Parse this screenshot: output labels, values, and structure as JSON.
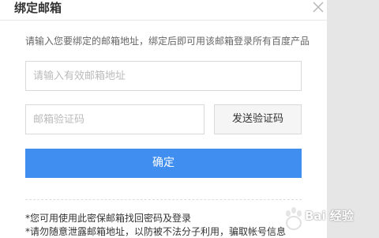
{
  "dialog": {
    "title": "绑定邮箱",
    "intro": "请输入您要绑定的邮箱地址，绑定后即可用该邮箱登录所有百度产品",
    "email_input": {
      "value": "",
      "placeholder": "请输入有效邮箱地址"
    },
    "code_input": {
      "value": "",
      "placeholder": "邮箱验证码"
    },
    "send_code_label": "发送验证码",
    "confirm_label": "确定",
    "notes": [
      "*您可用使用此密保邮箱找回密码及登录",
      "*请勿随意泄露邮箱地址，以防被不法分子利用，骗取帐号信息"
    ]
  },
  "watermark": {
    "text": "Bai 经验"
  },
  "icons": {
    "close": "close-icon",
    "watermark_logo": "baidu-paw-logo"
  },
  "colors": {
    "primary": "#3f8ef0",
    "dialog_bg": "#ffffff",
    "overlay": "#e6e6e6"
  }
}
